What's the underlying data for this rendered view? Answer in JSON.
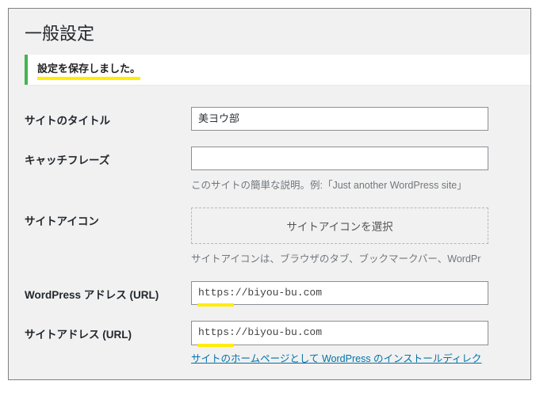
{
  "page": {
    "title": "一般設定"
  },
  "notice": {
    "message": "設定を保存しました。"
  },
  "fields": {
    "site_title": {
      "label": "サイトのタイトル",
      "value": "美ヨウ部"
    },
    "tagline": {
      "label": "キャッチフレーズ",
      "value": "",
      "description": "このサイトの簡単な説明。例:「Just another WordPress site」"
    },
    "site_icon": {
      "label": "サイトアイコン",
      "button": "サイトアイコンを選択",
      "description": "サイトアイコンは、ブラウザのタブ、ブックマークバー、WordPr"
    },
    "wp_url": {
      "label": "WordPress アドレス (URL)",
      "value": "https://biyou-bu.com"
    },
    "site_url": {
      "label": "サイトアドレス (URL)",
      "value": "https://biyou-bu.com",
      "link": "サイトのホームページとして WordPress のインストールディレク"
    }
  }
}
